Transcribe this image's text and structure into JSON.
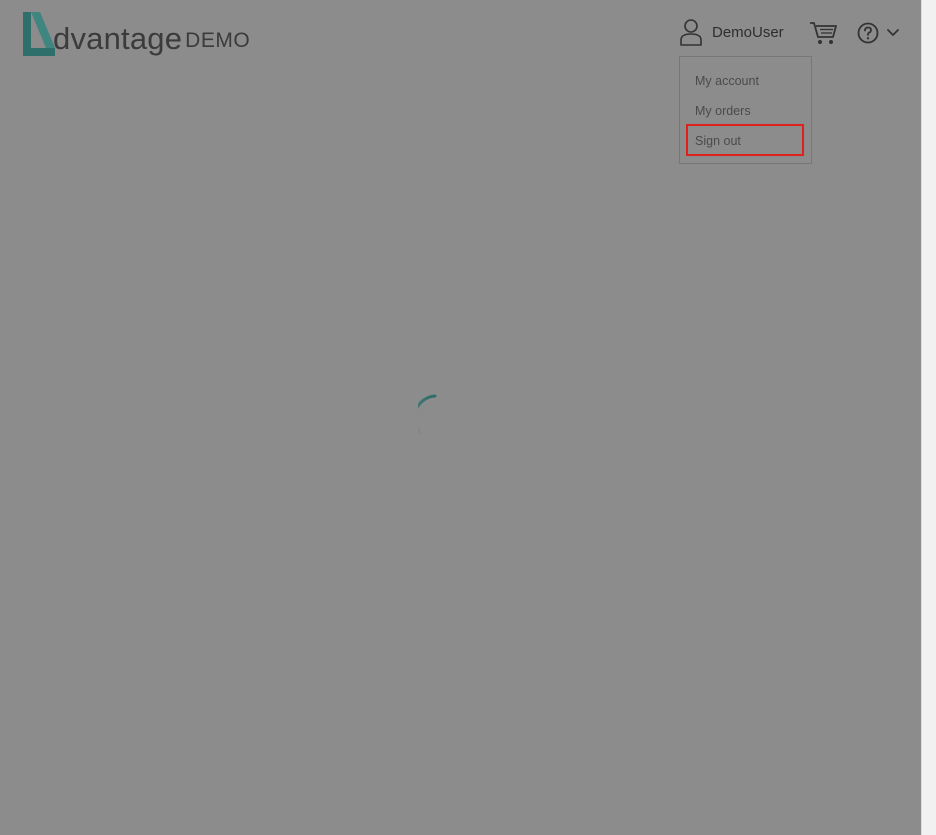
{
  "header": {
    "logo": {
      "word": "dvantage",
      "suffix": "DEMO"
    },
    "user": {
      "name": "DemoUser"
    }
  },
  "user_menu": {
    "items": [
      {
        "label": "My account"
      },
      {
        "label": "My orders"
      },
      {
        "label": "Sign out"
      }
    ]
  },
  "icons": {
    "user": "user-icon",
    "cart": "cart-icon",
    "help": "help-icon",
    "chevron": "chevron-down-icon",
    "loading": "loading-spinner"
  },
  "colors": {
    "overlay": "#8c8c8c",
    "brand_teal": "#2f6f6b",
    "highlight": "#e0201a",
    "text": "#2e2e2e"
  }
}
